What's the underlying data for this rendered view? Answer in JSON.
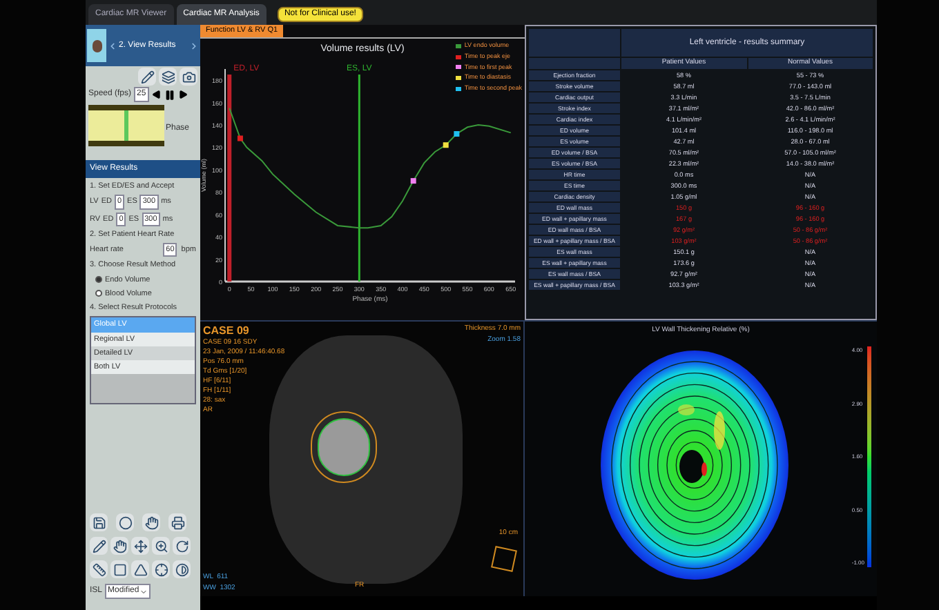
{
  "top_tabs": [
    {
      "label": "Cardiac MR Viewer",
      "selected": false
    },
    {
      "label": "Cardiac MR Analysis",
      "selected": true
    }
  ],
  "warning_badge": "Not for Clinical use!",
  "sidebar": {
    "step_title": "2. View Results",
    "speed_label": "Speed (fps)",
    "speed_value": "25",
    "phase_label": "Phase",
    "panel_title": "View Results",
    "step1": "1. Set ED/ES and Accept",
    "edes_rows": [
      {
        "label": "LV",
        "ed_label": "ED",
        "ed": "0",
        "es_label": "ES",
        "es": "300",
        "unit": "ms"
      },
      {
        "label": "RV",
        "ed_label": "ED",
        "ed": "0",
        "es_label": "ES",
        "es": "300",
        "unit": "ms"
      }
    ],
    "step2": "2. Set Patient Heart Rate",
    "heart_rate_label": "Heart rate",
    "heart_rate": "60",
    "heart_rate_unit": "bpm",
    "step3": "3. Choose Result Method",
    "methods": [
      {
        "label": "Endo Volume",
        "selected": true
      },
      {
        "label": "Blood Volume",
        "selected": false
      }
    ],
    "step4": "4. Select Result Protocols",
    "protocols": [
      {
        "label": "Global LV",
        "selected": true
      },
      {
        "label": "Regional LV",
        "selected": false
      },
      {
        "label": "Detailed LV",
        "selected": false
      },
      {
        "label": "Both LV",
        "selected": false
      }
    ],
    "zoom_label": "ISL",
    "zoom_value": "Modified"
  },
  "chart_panel": {
    "tab": "Function LV & RV Q1",
    "chart_data": {
      "type": "line",
      "title": "Volume results (LV)",
      "xlabel": "Phase (ms)",
      "ylabel": "Volume (ml)",
      "x": [
        0,
        25,
        40,
        75,
        100,
        150,
        200,
        250,
        300,
        320,
        350,
        375,
        400,
        425,
        450,
        475,
        500,
        525,
        550,
        575,
        600,
        650
      ],
      "series": [
        {
          "name": "LV endo volume",
          "color": "#3a9a3a",
          "values": [
            155,
            128,
            120,
            108,
            96,
            78,
            62,
            50,
            48,
            48,
            50,
            58,
            72,
            90,
            106,
            116,
            122,
            132,
            138,
            140,
            139,
            133
          ]
        },
        {
          "name": "Time to peak eje",
          "color": "#e02020",
          "marker": "square",
          "values": [
            null,
            128,
            null,
            null,
            null,
            null,
            null,
            null,
            null,
            null,
            null,
            null,
            null,
            null,
            null,
            null,
            null,
            null,
            null,
            null,
            null,
            null
          ]
        },
        {
          "name": "Time to first peak",
          "color": "#f080f0",
          "marker": "square",
          "values": [
            null,
            null,
            null,
            null,
            null,
            null,
            null,
            null,
            null,
            null,
            null,
            null,
            null,
            90,
            null,
            null,
            null,
            null,
            null,
            null,
            null,
            null
          ]
        },
        {
          "name": "Time to diastasis",
          "color": "#f0e040",
          "marker": "square",
          "values": [
            null,
            null,
            null,
            null,
            null,
            null,
            null,
            null,
            null,
            null,
            null,
            null,
            null,
            null,
            null,
            null,
            122,
            null,
            null,
            null,
            null,
            null
          ]
        },
        {
          "name": "Time to second peak",
          "color": "#20c0f0",
          "marker": "square",
          "values": [
            null,
            null,
            null,
            null,
            null,
            null,
            null,
            null,
            null,
            null,
            null,
            null,
            null,
            null,
            null,
            null,
            null,
            132,
            null,
            null,
            null,
            null
          ]
        }
      ],
      "ref_lines": [
        {
          "axis": "x",
          "value": 0,
          "label": "ED, LV",
          "color": "#c0202a"
        },
        {
          "axis": "x",
          "value": 300,
          "label": "ES, LV",
          "color": "#2fb52f"
        }
      ],
      "xlim": [
        -10,
        660
      ],
      "ylim": [
        0,
        190
      ],
      "xticks": [
        0,
        50,
        100,
        150,
        200,
        250,
        300,
        350,
        400,
        450,
        500,
        550,
        600,
        650
      ],
      "yticks": [
        0,
        20,
        40,
        60,
        80,
        100,
        120,
        140,
        160,
        180
      ]
    }
  },
  "results_table": {
    "title": "Left ventricle - results summary",
    "columns": [
      "Patient Values",
      "Normal Values"
    ],
    "rows": [
      {
        "label": "Ejection fraction",
        "value": "58 %",
        "normal": "55 - 73 %",
        "abnormal": false
      },
      {
        "label": "Stroke volume",
        "value": "58.7 ml",
        "normal": "77.0 - 143.0 ml",
        "abnormal": false
      },
      {
        "label": "Cardiac output",
        "value": "3.3 L/min",
        "normal": "3.5 - 7.5 L/min",
        "abnormal": false
      },
      {
        "label": "Stroke index",
        "value": "37.1 ml/m²",
        "normal": "42.0 - 86.0 ml/m²",
        "abnormal": false
      },
      {
        "label": "Cardiac index",
        "value": "4.1 L/min/m²",
        "normal": "2.6 - 4.1 L/min/m²",
        "abnormal": false
      },
      {
        "label": "ED volume",
        "value": "101.4 ml",
        "normal": "116.0 - 198.0 ml",
        "abnormal": false
      },
      {
        "label": "ES volume",
        "value": "42.7 ml",
        "normal": "28.0 - 67.0 ml",
        "abnormal": false
      },
      {
        "label": "ED volume / BSA",
        "value": "70.5 ml/m²",
        "normal": "57.0 - 105.0 ml/m²",
        "abnormal": false
      },
      {
        "label": "ES volume / BSA",
        "value": "22.3 ml/m²",
        "normal": "14.0 - 38.0 ml/m²",
        "abnormal": false
      },
      {
        "label": "HR time",
        "value": "0.0 ms",
        "normal": "N/A",
        "abnormal": false
      },
      {
        "label": "ES time",
        "value": "300.0 ms",
        "normal": "N/A",
        "abnormal": false
      },
      {
        "label": "Cardiac density",
        "value": "1.05 g/ml",
        "normal": "N/A",
        "abnormal": false
      },
      {
        "label": "ED wall mass",
        "value": "150 g",
        "normal": "96 - 160 g",
        "abnormal": true
      },
      {
        "label": "ED wall + papillary mass",
        "value": "167 g",
        "normal": "96 - 160 g",
        "abnormal": true
      },
      {
        "label": "ED wall mass / BSA",
        "value": "92 g/m²",
        "normal": "50 - 86 g/m²",
        "abnormal": true
      },
      {
        "label": "ED wall + papillary mass / BSA",
        "value": "103 g/m²",
        "normal": "50 - 86 g/m²",
        "abnormal": true
      },
      {
        "label": "ES wall mass",
        "value": "150.1 g",
        "normal": "N/A",
        "abnormal": false
      },
      {
        "label": "ES wall + papillary mass",
        "value": "173.6 g",
        "normal": "N/A",
        "abnormal": false
      },
      {
        "label": "ES wall mass / BSA",
        "value": "92.7 g/m²",
        "normal": "N/A",
        "abnormal": false
      },
      {
        "label": "ES wall + papillary mass / BSA",
        "value": "103.3 g/m²",
        "normal": "N/A",
        "abnormal": false
      }
    ]
  },
  "image_view": {
    "info_lines": [
      "CASE 09",
      "CASE 09 16 SDY",
      "23 Jan, 2009 / 11:46:40.68",
      "Pos 76.0 mm",
      "Td Gms [1/20]",
      "HF [6/11]",
      "FH [1/11]",
      "28: sax",
      "AR"
    ],
    "thickness": "Thickness 7.0 mm",
    "zoom": "Zoom 1.58",
    "scale": "10 cm",
    "orientation_bottom": "FR",
    "wl": "WL  611",
    "ww": "WW  1302"
  },
  "bullseye": {
    "title": "LV Wall Thickening Relative (%)",
    "scale_labels": [
      "4.00",
      "2.90",
      "1.60",
      "0.50",
      "-1.00"
    ]
  }
}
